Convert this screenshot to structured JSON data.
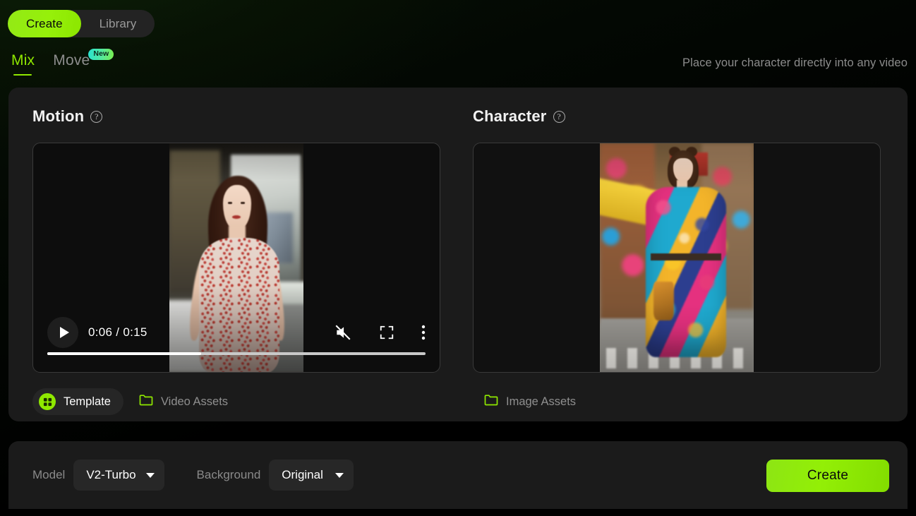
{
  "top_tabs": [
    {
      "label": "Create",
      "active": true
    },
    {
      "label": "Library",
      "active": false
    }
  ],
  "sub_tabs": [
    {
      "label": "Mix",
      "active": true,
      "badge": ""
    },
    {
      "label": "Move",
      "active": false,
      "badge": "New"
    }
  ],
  "tagline": "Place your character directly into any video",
  "motion": {
    "title": "Motion",
    "help_icon": "question-mark-circle-icon",
    "player": {
      "play_icon": "play-icon",
      "current_time": "0:06",
      "separator": "/",
      "duration": "0:15",
      "time_display": "0:06 / 0:15",
      "mute_icon": "volume-muted-icon",
      "fullscreen_icon": "fullscreen-icon",
      "more_icon": "kebab-menu-icon",
      "progress_percent": 40.6
    },
    "template_chip": {
      "label": "Template",
      "icon": "grid-icon",
      "active": true
    },
    "assets_link": {
      "label": "Video Assets",
      "icon": "folder-icon"
    }
  },
  "character": {
    "title": "Character",
    "help_icon": "question-mark-circle-icon",
    "assets_link": {
      "label": "Image Assets",
      "icon": "folder-icon"
    }
  },
  "bottom_bar": {
    "model_label": "Model",
    "model_value": "V2-Turbo",
    "background_label": "Background",
    "background_value": "Original",
    "create_label": "Create"
  },
  "colors": {
    "accent_green": "#8fe800",
    "badge_gradient_start": "#29e2d0",
    "badge_gradient_end": "#7bee4d",
    "panel_bg": "#1b1b1b",
    "page_bg": "#000000",
    "muted_text": "#8a8a8a"
  }
}
